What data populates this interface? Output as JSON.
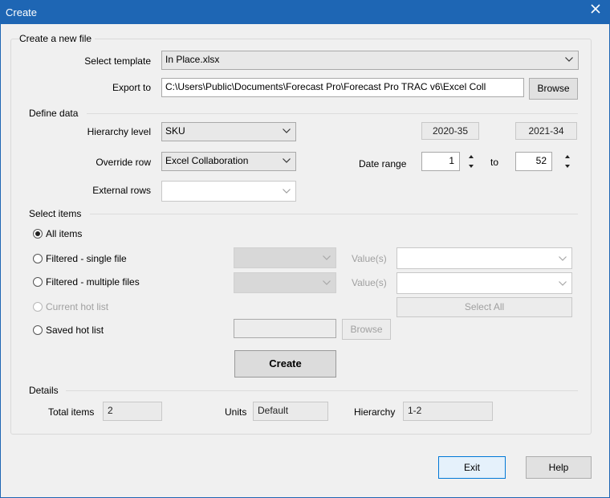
{
  "window": {
    "title": "Create",
    "close_glyph": "×"
  },
  "create_file": {
    "section_label": "Create a new file",
    "template_label": "Select template",
    "template_value": "In Place.xlsx",
    "export_label": "Export to",
    "export_value": "C:\\Users\\Public\\Documents\\Forecast Pro\\Forecast Pro TRAC v6\\Excel Coll",
    "browse_label": "Browse"
  },
  "define_data": {
    "section_label": "Define data",
    "hierarchy_label": "Hierarchy level",
    "hierarchy_value": "SKU",
    "override_label": "Override row",
    "override_value": "Excel Collaboration",
    "external_label": "External rows",
    "external_value": "",
    "period_start": "2020-35",
    "period_end": "2021-34",
    "date_range_label": "Date range",
    "range_from": "1",
    "to_label": "to",
    "range_to": "52"
  },
  "select_items": {
    "section_label": "Select items",
    "options": [
      {
        "label": "All items",
        "checked": true,
        "enabled": true
      },
      {
        "label": "Filtered - single file",
        "checked": false,
        "enabled": true
      },
      {
        "label": "Filtered - multiple files",
        "checked": false,
        "enabled": true
      },
      {
        "label": "Current hot list",
        "checked": false,
        "enabled": false
      },
      {
        "label": "Saved hot list",
        "checked": false,
        "enabled": true
      }
    ],
    "values_label": "Value(s)",
    "select_all_label": "Select All",
    "browse_label": "Browse",
    "create_label": "Create"
  },
  "details": {
    "section_label": "Details",
    "total_items_label": "Total items",
    "total_items_value": "2",
    "units_label": "Units",
    "units_value": "Default",
    "hierarchy_label": "Hierarchy",
    "hierarchy_value": "1-2"
  },
  "footer": {
    "exit_label": "Exit",
    "help_label": "Help"
  },
  "colors": {
    "titlebar": "#1e66b4",
    "dialog_bg": "#f0f0f0",
    "primary_border": "#0078d7"
  },
  "icons": {
    "close": "close-icon",
    "dropdown": "chevron-down-icon",
    "spinner": "spin-arrows-icon"
  }
}
